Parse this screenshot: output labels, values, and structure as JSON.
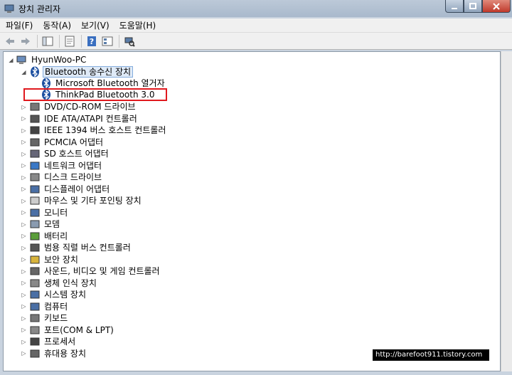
{
  "window": {
    "title": "장치 관리자"
  },
  "menu": [
    "파일(F)",
    "동작(A)",
    "보기(V)",
    "도움말(H)"
  ],
  "toolbar": [
    "back-icon",
    "forward-icon",
    "show-hide-tree-icon",
    "properties-icon",
    "help-icon",
    "view-icon",
    "scan-hardware-icon"
  ],
  "tree": {
    "root": "HyunWoo-PC",
    "bluetooth_group": "Bluetooth 송수신 장치",
    "bluetooth_children": [
      "Microsoft Bluetooth 열거자",
      "ThinkPad Bluetooth 3.0"
    ],
    "categories": [
      "DVD/CD-ROM 드라이브",
      "IDE ATA/ATAPI 컨트롤러",
      "IEEE 1394 버스 호스트 컨트롤러",
      "PCMCIA 어댑터",
      "SD 호스트 어댑터",
      "네트워크 어댑터",
      "디스크 드라이브",
      "디스플레이 어댑터",
      "마우스 및 기타 포인팅 장치",
      "모니터",
      "모뎀",
      "배터리",
      "범용 직렬 버스 컨트롤러",
      "보안 장치",
      "사운드, 비디오 및 게임 컨트롤러",
      "생체 인식 장치",
      "시스템 장치",
      "컴퓨터",
      "키보드",
      "포트(COM & LPT)",
      "프로세서",
      "휴대용 장치"
    ]
  },
  "watermark": "http://barefoot911.tistory.com",
  "colors": {
    "highlight": "#e0191e",
    "selection": "#dfeaf7"
  }
}
